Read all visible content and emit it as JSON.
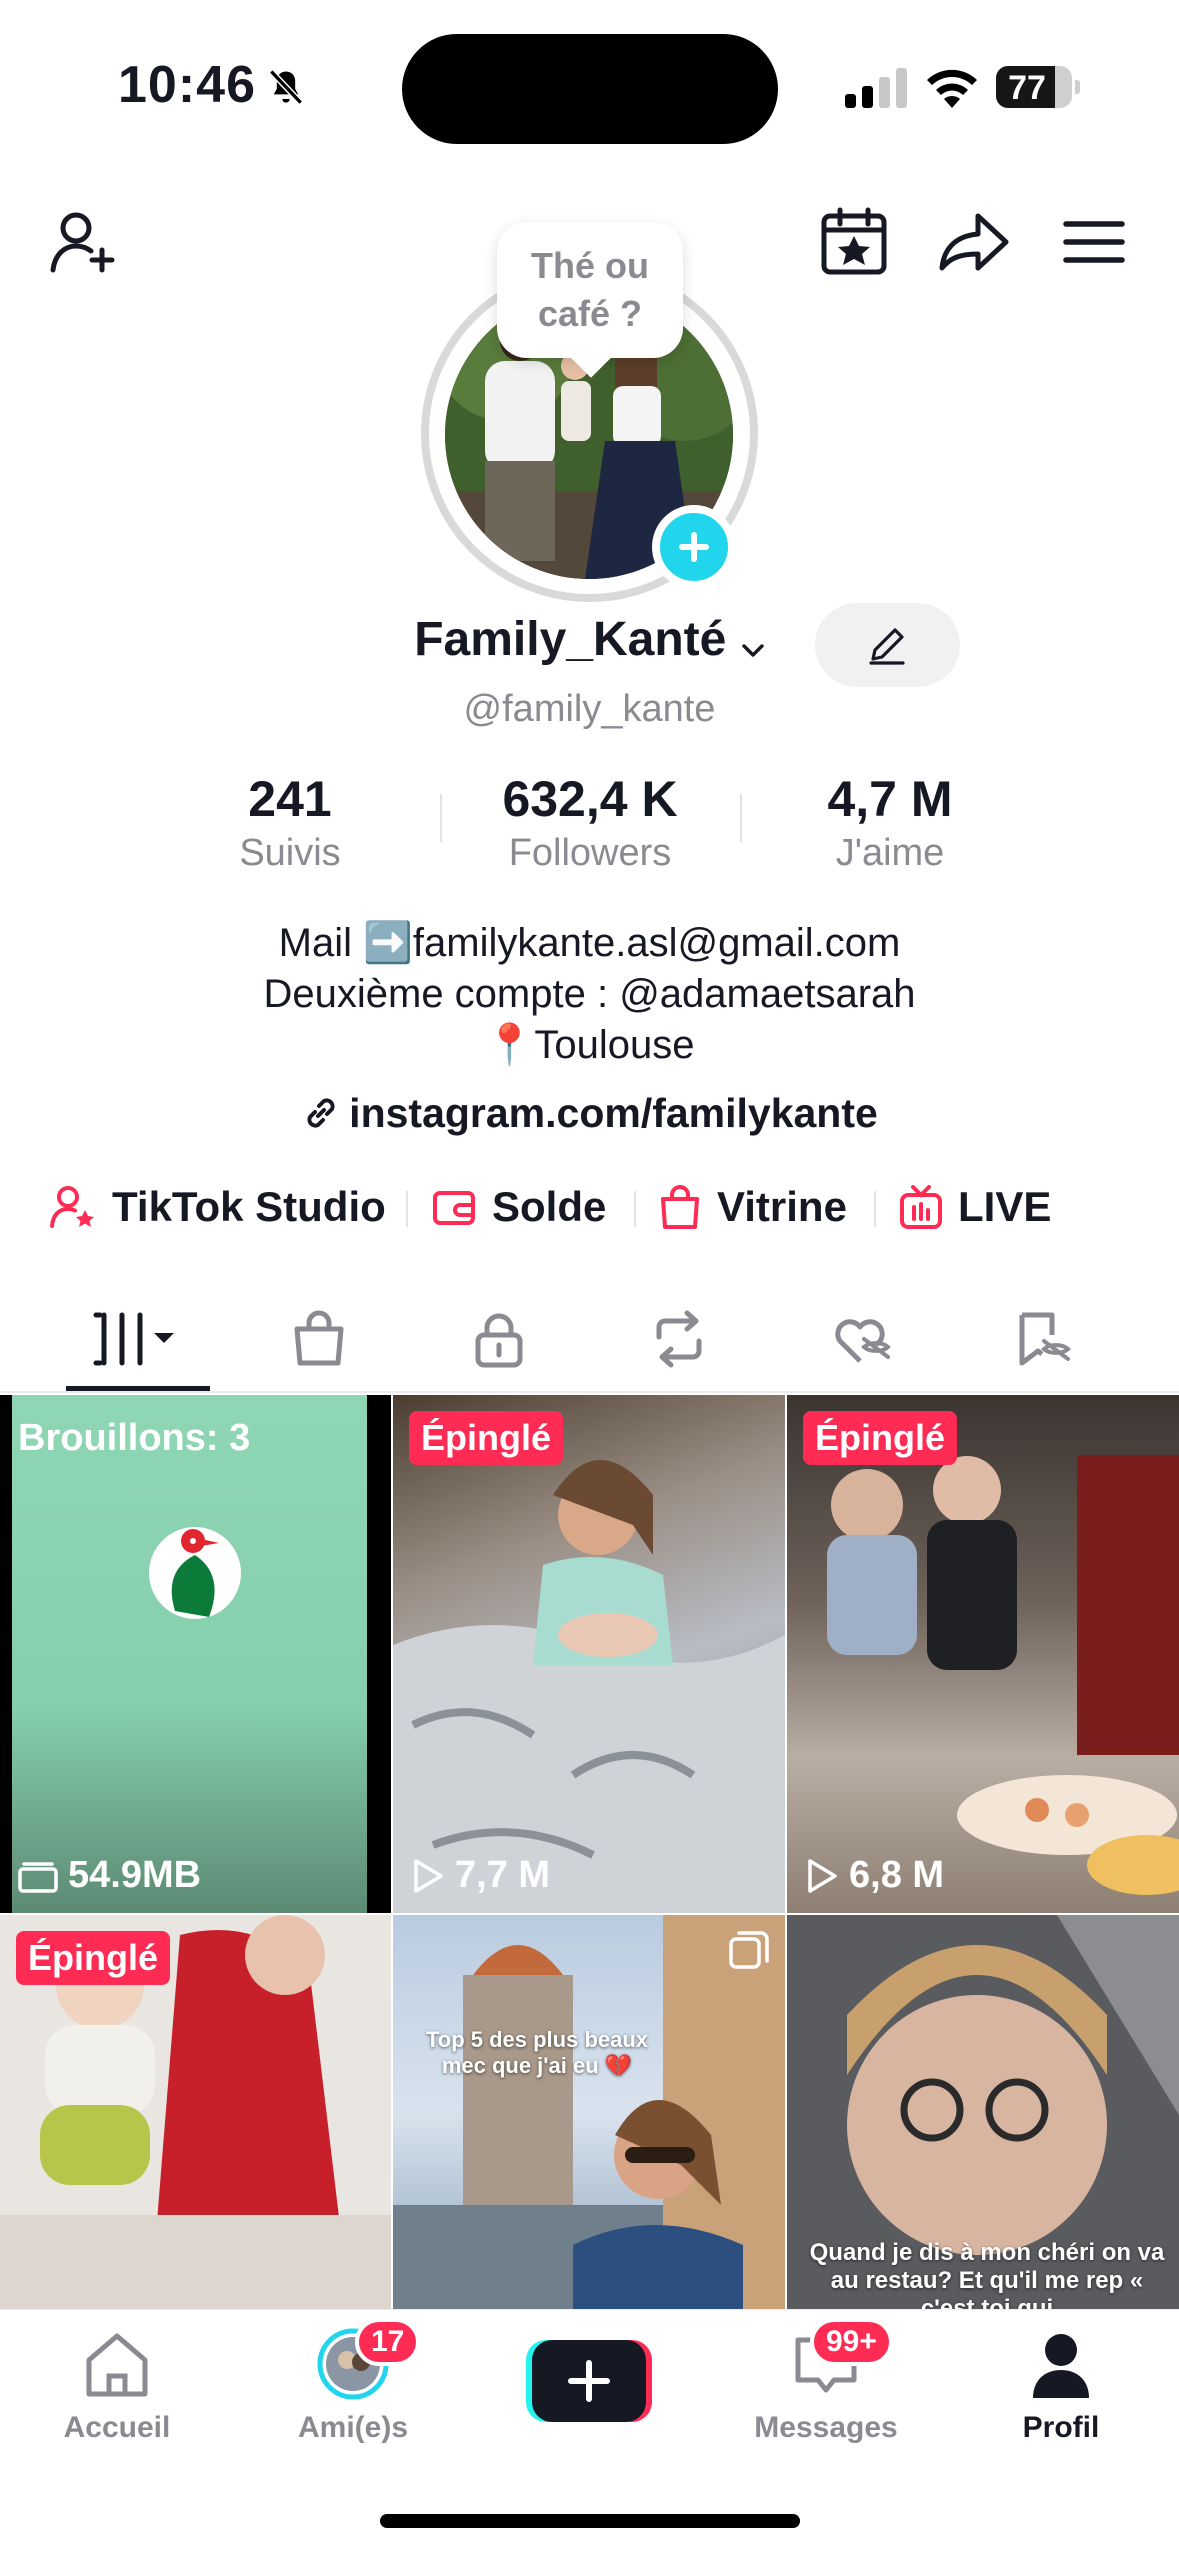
{
  "status_bar": {
    "time": "10:46",
    "battery": "77",
    "battery_level": 0.77
  },
  "profile": {
    "bubble_text": "Thé ou café ?",
    "display_name": "Family_Kanté",
    "handle": "@family_kante",
    "stats": [
      {
        "value": "241",
        "label": "Suivis"
      },
      {
        "value": "632,4 K",
        "label": "Followers"
      },
      {
        "value": "4,7 M",
        "label": "J'aime"
      }
    ],
    "bio": {
      "line1": "Mail ➡️familykante.asl@gmail.com",
      "line2": "Deuxième compte :  @adamaetsarah",
      "line3": "📍Toulouse"
    },
    "link": "instagram.com/familykante"
  },
  "tools": {
    "studio": "TikTok Studio",
    "solde": "Solde",
    "vitrine": "Vitrine",
    "live": "LIVE"
  },
  "grid": {
    "drafts_label": "Brouillons: 3",
    "drafts_size": "54.9MB",
    "pinned_label": "Épinglé",
    "video2_views": "7,7 M",
    "video3_views": "6,8 M",
    "video5_caption": "Top 5 des plus beaux mec que j'ai eu 💔",
    "video6_caption": "Quand je dis à mon chéri on va au restau? Et qu'il me rep « c'est toi qui"
  },
  "nav": {
    "home": "Accueil",
    "friends": "Ami(e)s",
    "friends_badge": "17",
    "messages": "Messages",
    "messages_badge": "99+",
    "profile": "Profil"
  },
  "colors": {
    "accent": "#fe2c55",
    "cyan": "#20d5ec",
    "text": "#161823",
    "muted": "#8a8b91"
  }
}
